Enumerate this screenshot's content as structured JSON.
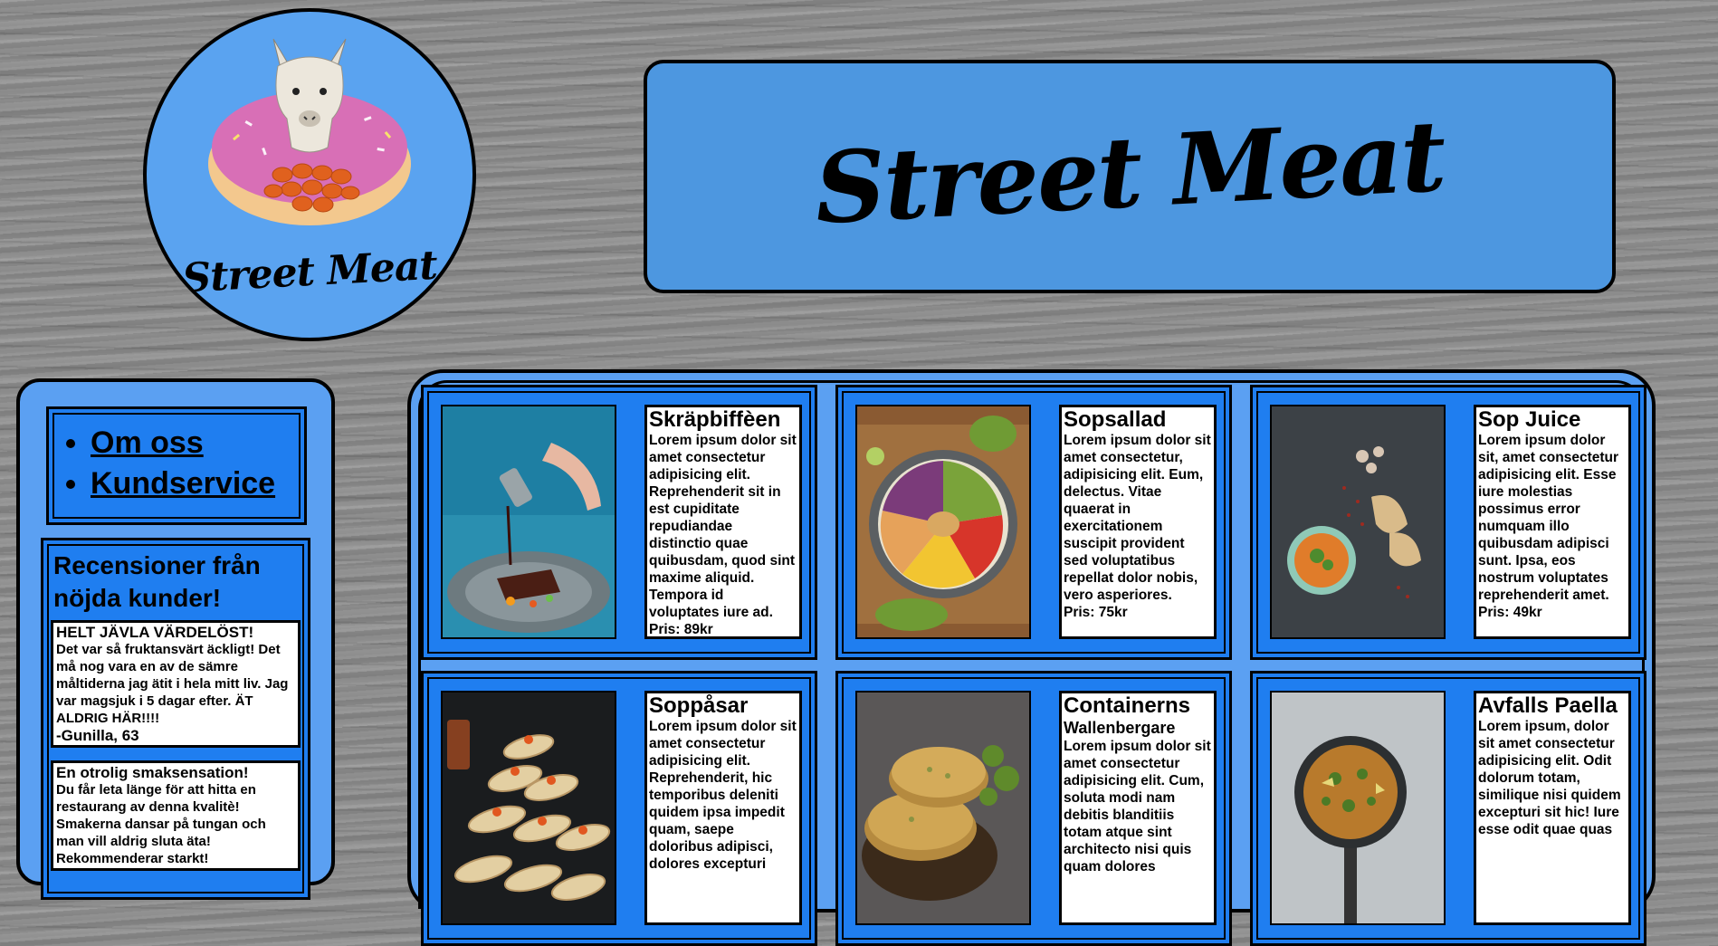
{
  "brand": {
    "logo_text": "Street Meat",
    "banner_title": "Street Meat"
  },
  "nav": {
    "items": [
      {
        "label": "Om oss"
      },
      {
        "label": "Kundservice"
      }
    ]
  },
  "reviews": {
    "heading": "Recensioner från nöjda kunder!",
    "items": [
      {
        "title": "HELT JÄVLA VÄRDELÖST!",
        "body": "Det var så fruktansvärt äckligt! Det må nog vara en av de sämre måltiderna jag ätit i hela mitt liv. Jag var magsjuk i 5 dagar efter. ÄT ALDRIG HÄR!!!!",
        "author": "-Gunilla, 63"
      },
      {
        "title": "En otrolig smaksensation!",
        "body": "Du får leta länge för att hitta en restaurang av denna kvalitè! Smakerna dansar på tungan och man vill aldrig sluta äta! Rekommenderar starkt!",
        "author": ""
      }
    ]
  },
  "menu": {
    "items": [
      {
        "name": "Skräpbiffèen",
        "subtitle": "",
        "description": "Lorem ipsum dolor sit amet consectetur adipisicing elit. Reprehenderit sit in est cupiditate repudiandae distinctio quae quibusdam, quod sint maxime aliquid. Tempora id voluptates iure ad.",
        "price": "Pris: 89kr",
        "photo": "steak-sauce-photo"
      },
      {
        "name": "Sopsallad",
        "subtitle": "",
        "description": "Lorem ipsum dolor sit amet consectetur, adipisicing elit. Eum, delectus. Vitae quaerat in exercitationem suscipit provident sed voluptatibus repellat dolor nobis, vero asperiores.",
        "price": "Pris: 75kr",
        "photo": "salad-bowl-photo"
      },
      {
        "name": "Sop Juice",
        "subtitle": "",
        "description": "Lorem ipsum dolor sit, amet consectetur adipisicing elit. Esse iure molestias possimus error numquam illo quibusdam adipisci sunt. Ipsa, eos nostrum voluptates reprehenderit amet.",
        "price": "Pris: 49kr",
        "photo": "soup-bowl-photo"
      },
      {
        "name": "Soppåsar",
        "subtitle": "",
        "description": "Lorem ipsum dolor sit amet consectetur adipisicing elit. Reprehenderit, hic temporibus deleniti quidem ipsa impedit quam, saepe doloribus adipisci, dolores excepturi",
        "price": "",
        "photo": "crepe-rolls-photo"
      },
      {
        "name": "Containerns",
        "subtitle": "Wallenbergare",
        "description": "Lorem ipsum dolor sit amet consectetur adipisicing elit. Cum, soluta modi nam debitis blanditiis totam atque sint architecto nisi quis quam dolores",
        "price": "",
        "photo": "patties-photo"
      },
      {
        "name": "Avfalls Paella",
        "subtitle": "",
        "description": "Lorem ipsum, dolor sit amet consectetur adipisicing elit. Odit dolorum totam, similique nisi quidem excepturi sit hic! Iure esse odit quae quas",
        "price": "",
        "photo": "paella-pan-photo"
      }
    ]
  }
}
